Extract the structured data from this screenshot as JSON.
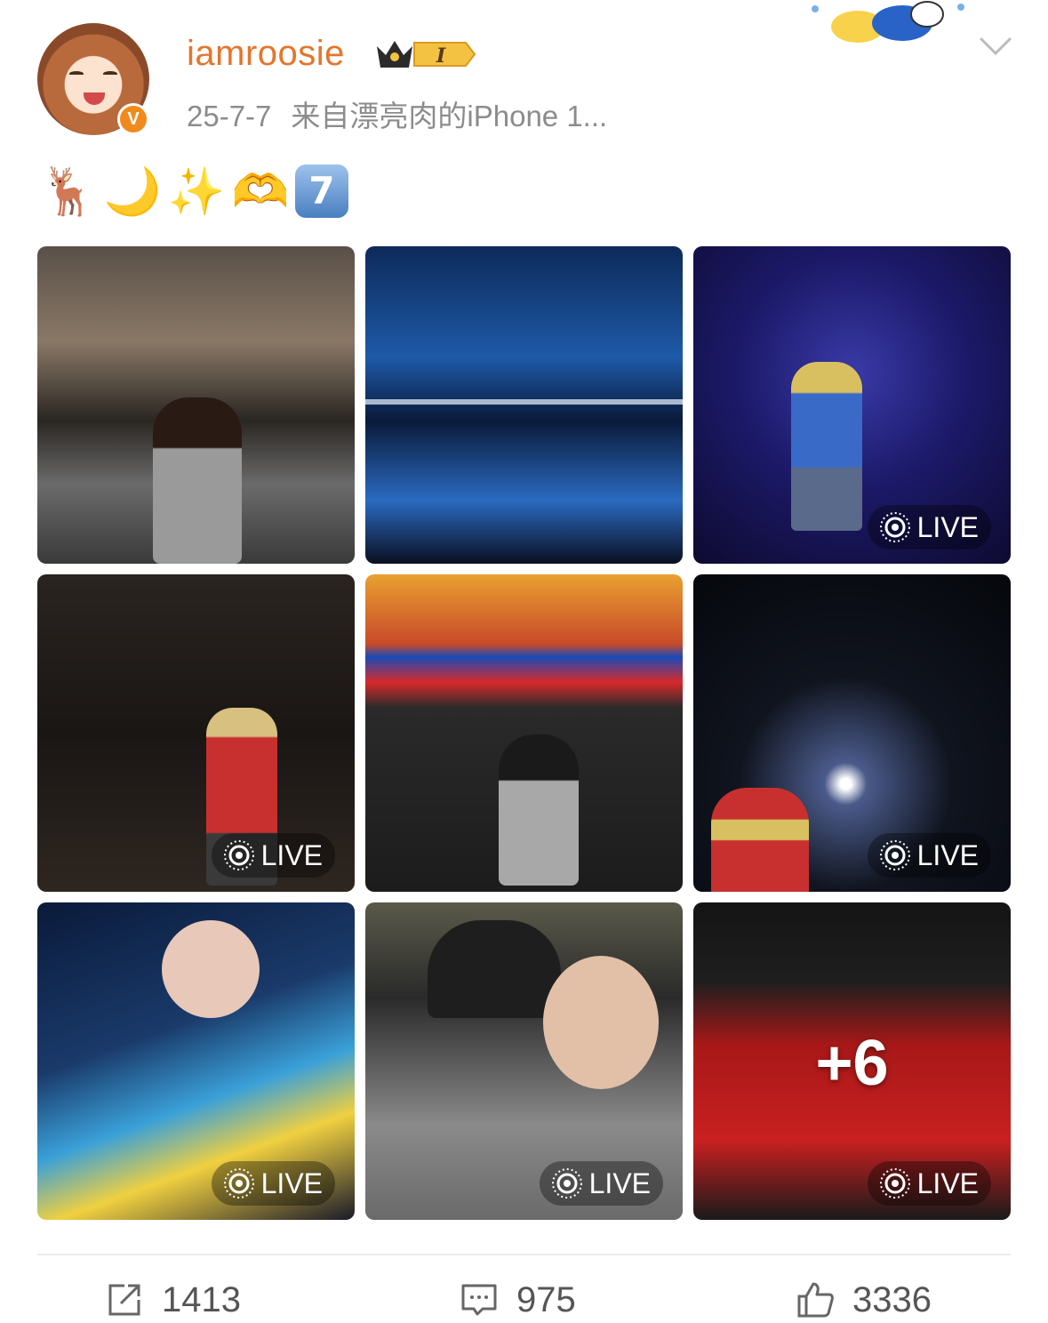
{
  "post": {
    "username": "iamroosie",
    "vip_level": "I",
    "date": "25-7-7",
    "source": "来自漂亮肉的iPhone 1...",
    "verified_mark": "V",
    "emojis": [
      "🦌",
      "🌙",
      "✨",
      "🫶"
    ],
    "keycap_number": "7"
  },
  "gallery": {
    "live_label": "LIVE",
    "more_count": "+6",
    "tiles": [
      {
        "live": false
      },
      {
        "live": false
      },
      {
        "live": true
      },
      {
        "live": true
      },
      {
        "live": false
      },
      {
        "live": true
      },
      {
        "live": true
      },
      {
        "live": true
      },
      {
        "live": true,
        "more": true
      }
    ]
  },
  "actions": {
    "repost_count": "1413",
    "comment_count": "975",
    "like_count": "3336"
  },
  "colors": {
    "username": "#e5752c",
    "meta": "#8c8c8c",
    "verified": "#f08a1c"
  }
}
